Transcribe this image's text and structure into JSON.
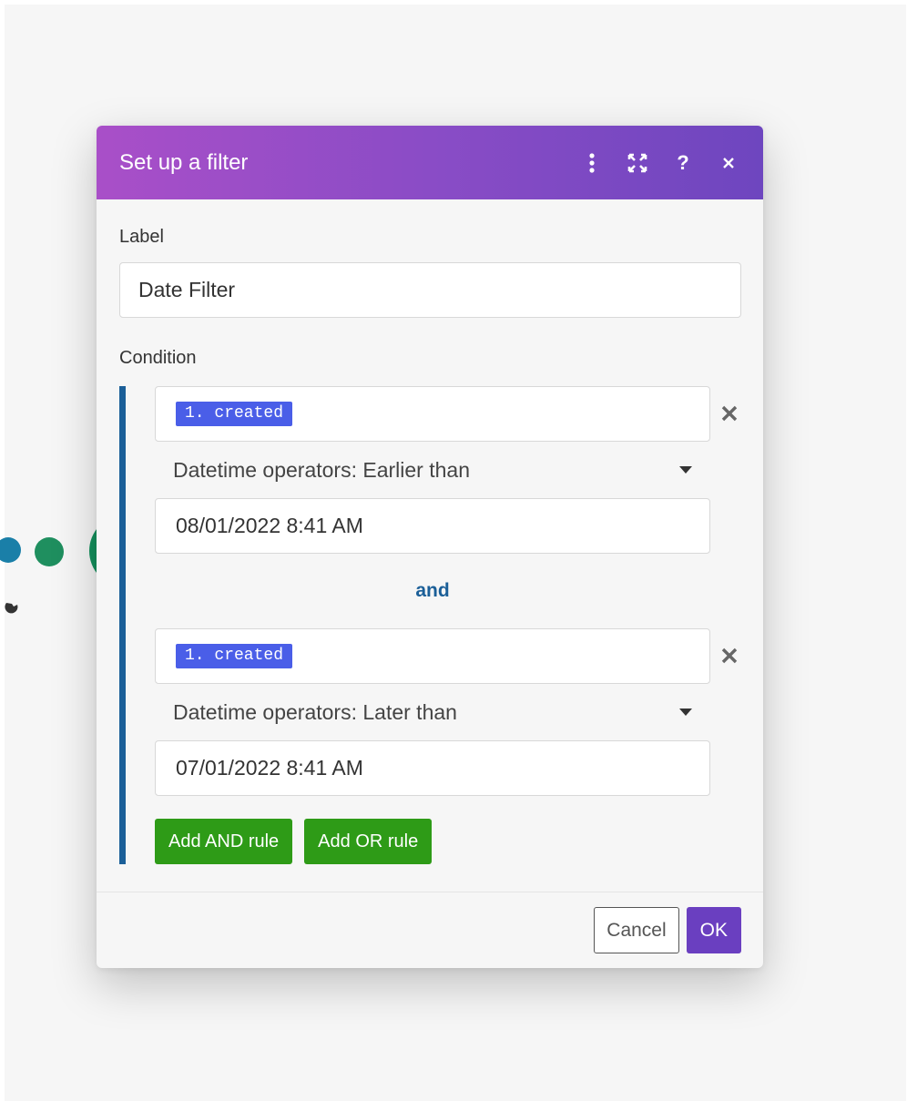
{
  "modal": {
    "title": "Set up a filter",
    "header_icons": [
      "more-vertical-icon",
      "fullscreen-icon",
      "help-icon",
      "close-icon"
    ],
    "header_gradient": [
      "#a94fc8",
      "#6e46bf"
    ]
  },
  "label_field": {
    "label": "Label",
    "value": "Date Filter"
  },
  "condition": {
    "label": "Condition",
    "rules": [
      {
        "field_pill": "1. created",
        "operator": "Datetime operators: Earlier than",
        "value": "08/01/2022 8:41 AM"
      },
      {
        "field_pill": "1. created",
        "operator": "Datetime operators: Later than",
        "value": "07/01/2022 8:41 AM"
      }
    ],
    "joiner": "and",
    "add_and_label": "Add AND rule",
    "add_or_label": "Add OR rule"
  },
  "footer": {
    "cancel_label": "Cancel",
    "ok_label": "OK"
  },
  "colors": {
    "accent_purple": "#6a3fc0",
    "rule_green": "#2e9b17",
    "condition_bar": "#1b5f98",
    "pill_blue": "#4a5ee8"
  }
}
